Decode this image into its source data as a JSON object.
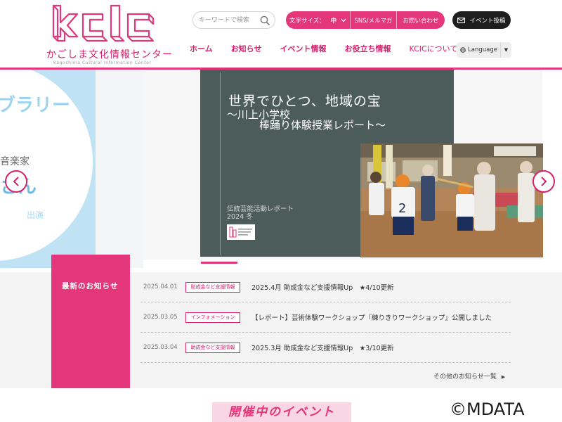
{
  "header": {
    "logo_name": "かごしま文化情報センター",
    "logo_sub": "Kagoshima Cultural Information Center",
    "search_placeholder": "キーワードで検索",
    "font_size_label": "文字サイズ：",
    "font_size_value": "中",
    "sns_label": "SNS/メルマガ",
    "contact_label": "お問い合わせ",
    "event_post_label": "イベント投稿",
    "language_label": "Language"
  },
  "nav": [
    "ホーム",
    "お知らせ",
    "イベント情報",
    "お役立ち情報",
    "KCICについて"
  ],
  "hero": {
    "left_slide": {
      "text1": "ブラリー",
      "text2": "音楽家",
      "text3": "さん",
      "text4": "出演"
    },
    "main_slide": {
      "title": "世界でひとつ、地域の宝",
      "subtitle1": "〜川上小学校",
      "subtitle2": "棒踊り体験授業レポート〜",
      "report_label": "伝統芸能活動レポート",
      "year_label": "2024 冬"
    }
  },
  "news": {
    "heading": "最新のお知らせ",
    "items": [
      {
        "date": "2025.04.01",
        "tag": "助成金など支援情報",
        "text": "2025.4月 助成金など支援情報Up　★4/10更新"
      },
      {
        "date": "2025.03.05",
        "tag": "インフォメーション",
        "text": "【レポート】芸術体験ワークショップ『練りきりワークショップ』公開しました"
      },
      {
        "date": "2025.03.04",
        "tag": "助成金など支援情報",
        "text": "2025.3月 助成金など支援情報Up　★3/10更新"
      }
    ],
    "more_label": "その他のお知らせ一覧"
  },
  "events_heading": "開催中のイベント",
  "copyright": "©MDATA",
  "colors": {
    "brand_pink": "#e4367a",
    "dark_button": "#1e1e1e",
    "slide_dark": "#4b5c5b"
  }
}
